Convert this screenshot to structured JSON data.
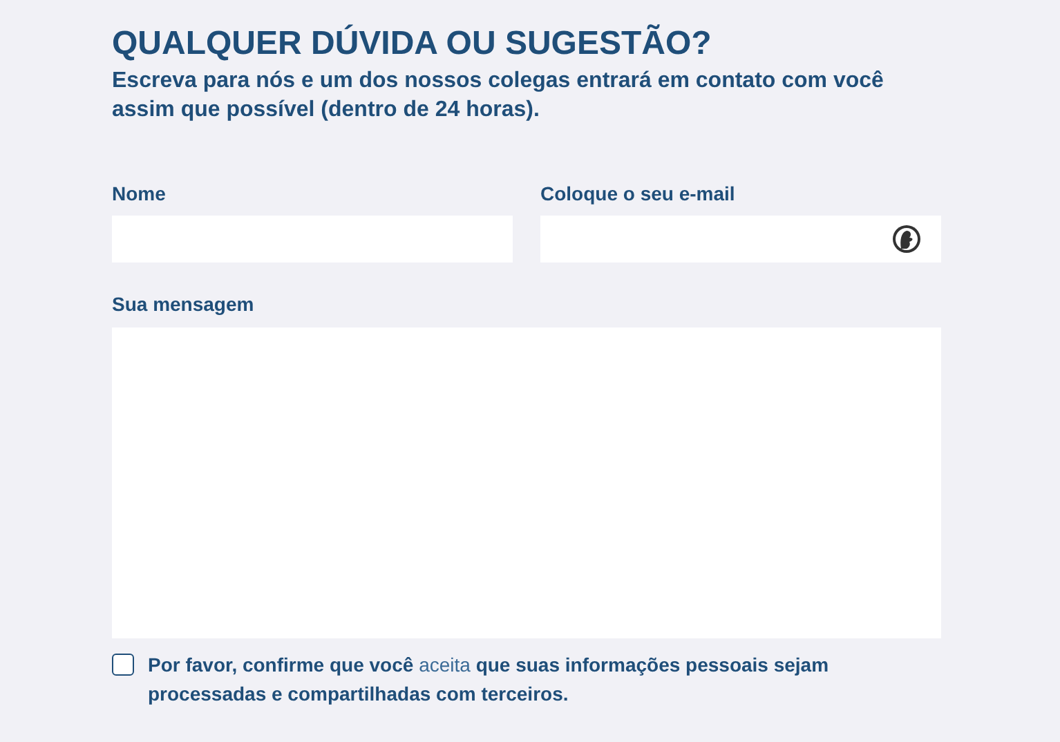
{
  "heading": "QUALQUER DÚVIDA OU SUGESTÃO?",
  "subheading": "Escreva para nós e um dos nossos colegas entrará em contato com você assim que possível (dentro de 24 horas).",
  "fields": [
    {
      "label": "Nome",
      "kind": "text"
    },
    {
      "label": "Coloque o seu e-mail",
      "kind": "email"
    }
  ],
  "message": {
    "label": "Sua mensagem"
  },
  "consent": {
    "checked": false,
    "text_before": "Por favor, confirme que você",
    "link": "aceita",
    "text_after": "que suas informações pessoais sejam processadas e compartilhadas com terceiros."
  }
}
